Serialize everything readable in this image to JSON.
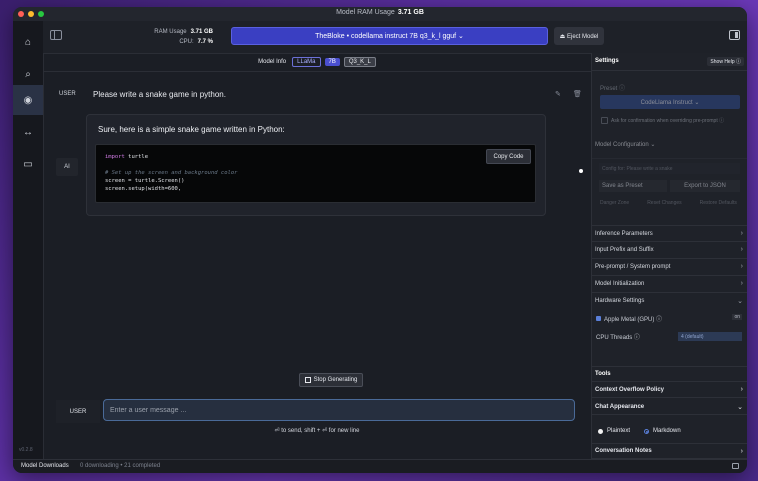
{
  "window": {
    "title_label": "Model RAM Usage",
    "title_value": "3.71 GB"
  },
  "leftbar": {
    "items": [
      {
        "icon": "home-icon",
        "glyph": "⌂"
      },
      {
        "icon": "search-icon",
        "glyph": "⌕"
      },
      {
        "icon": "chat-icon",
        "glyph": "◉"
      },
      {
        "icon": "swap-arrows-icon",
        "glyph": "↔"
      },
      {
        "icon": "folder-icon",
        "glyph": "▭"
      }
    ],
    "version": "v0.2.8"
  },
  "topbar": {
    "ram_label": "RAM Usage",
    "ram_value": "3.71 GB",
    "cpu_label": "CPU:",
    "cpu_value": "7.7 %",
    "model_selected": "TheBloke • codellama instruct 7B q3_k_l gguf ⌄",
    "eject_label": "⏏ Eject Model"
  },
  "model_info": {
    "label": "Model Info",
    "tags": [
      "LLaMa",
      "7B",
      "Q3_K_L"
    ]
  },
  "chat": {
    "user_role": "USER",
    "user_message": "Please write a snake game in python.",
    "ai_role": "AI",
    "ai_intro": "Sure, here is a simple snake game written in Python:",
    "code": {
      "line1_kw": "import",
      "line1_rest": " turtle",
      "line2_comment": "# Set up the screen and background color",
      "line3": "screen = turtle.Screen()",
      "line4": "screen.setup(width=600,"
    },
    "copy_label": "Copy Code",
    "stop_label": "Stop Generating",
    "input_role": "USER",
    "input_placeholder": "Enter a user message ...",
    "input_hint": "⏎ to send, shift + ⏎ for new line"
  },
  "settings": {
    "title": "Settings",
    "help": "Show Help ⓘ",
    "preset_label": "Preset ⓘ",
    "preset_value": "CodeLlama Instruct ⌄",
    "ask_confirm": "Ask for confirmation when overriding pre-prompt ⓘ",
    "model_config": "Model Configuration ⌄",
    "config_placeholder": "Config for: Please write a snake",
    "save_preset": "Save as Preset",
    "export_json": "Export to JSON",
    "danger_label": "Danger Zone",
    "danger_a": "Reset Changes",
    "danger_b": "Restore Defaults",
    "rows": [
      "Inference Parameters",
      "Input Prefix and Suffix",
      "Pre-prompt / System prompt",
      "Model Initialization",
      "Hardware Settings"
    ],
    "metal_label": "Apple Metal (GPU) ⓘ",
    "metal_value": "on",
    "threads_label": "CPU Threads ⓘ",
    "threads_value": "4 (default)"
  },
  "tools": {
    "title": "Tools",
    "context_overflow": "Context Overflow Policy",
    "chat_appearance": "Chat Appearance",
    "plaintext": "Plaintext",
    "markdown": "Markdown",
    "conversation_notes": "Conversation Notes"
  },
  "bottombar": {
    "title": "Model Downloads",
    "status": "0 downloading • 21 completed"
  }
}
